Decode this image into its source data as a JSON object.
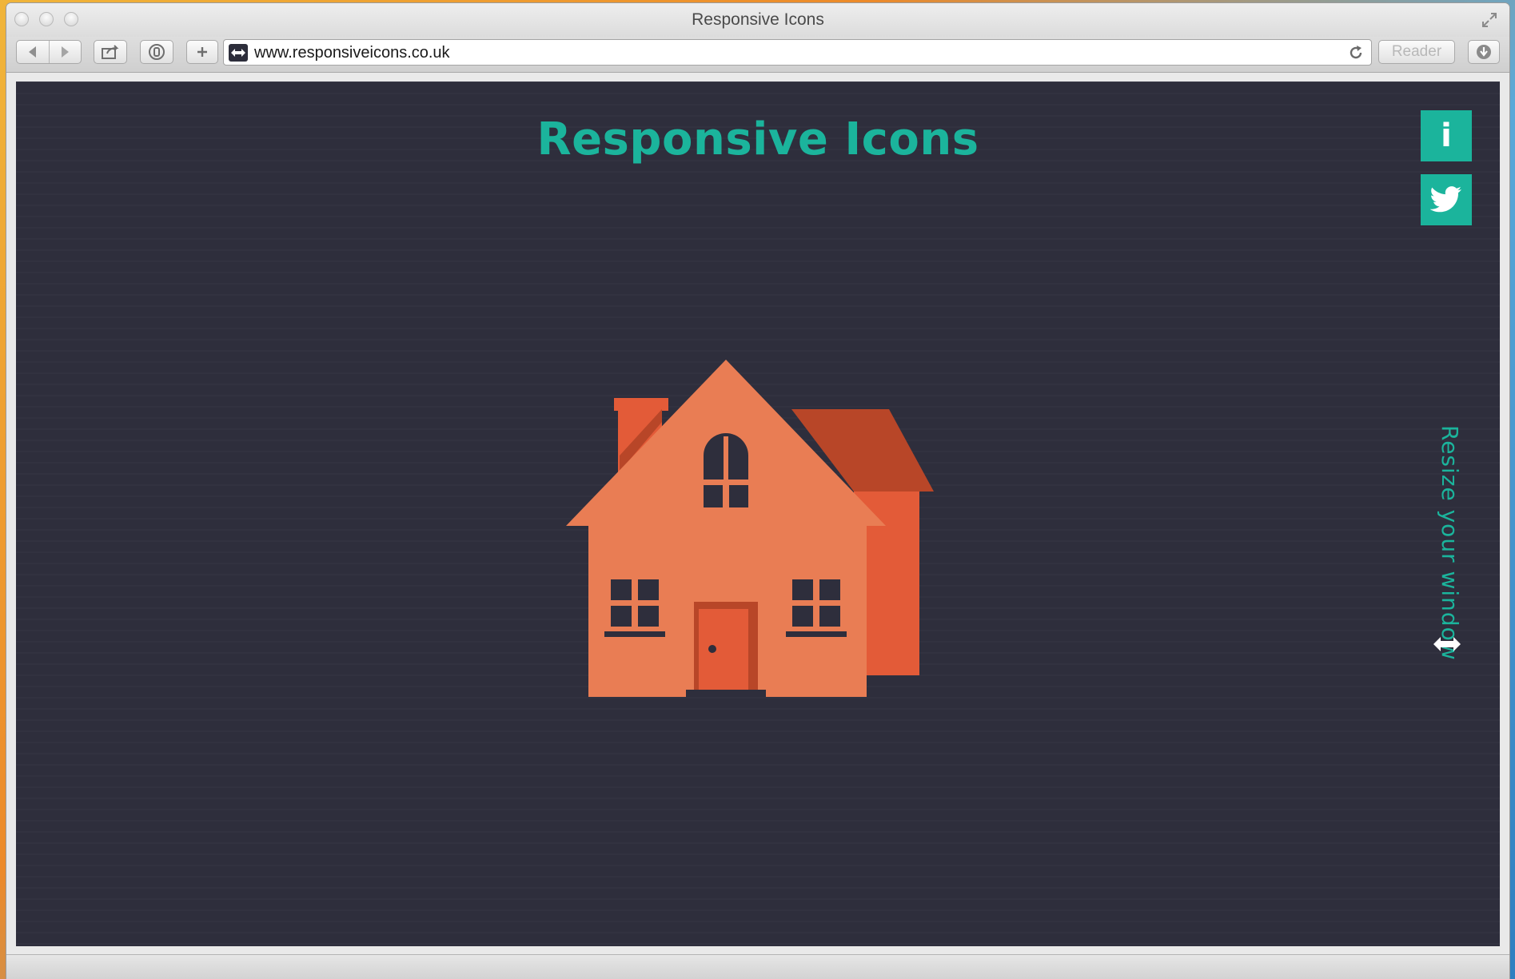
{
  "window": {
    "title": "Responsive Icons"
  },
  "toolbar": {
    "url": "www.responsiveicons.co.uk",
    "reader_label": "Reader"
  },
  "page": {
    "heading": "Responsive Icons",
    "info_label": "i",
    "resize_hint": "Resize your window"
  },
  "colors": {
    "accent": "#1bb49c",
    "background": "#2e2e3c",
    "house_main": "#e97d54",
    "house_dark": "#e35b38",
    "house_shadow": "#b84628"
  },
  "icons": {
    "back": "back-arrow-icon",
    "forward": "forward-arrow-icon",
    "share": "share-icon",
    "history": "top-sites-icon",
    "new_tab": "plus-icon",
    "favicon": "double-arrow-icon",
    "reload": "reload-icon",
    "download": "download-icon",
    "info": "info-icon",
    "twitter": "twitter-bird-icon",
    "resize": "horizontal-double-arrow-icon",
    "illustration": "house-icon"
  }
}
